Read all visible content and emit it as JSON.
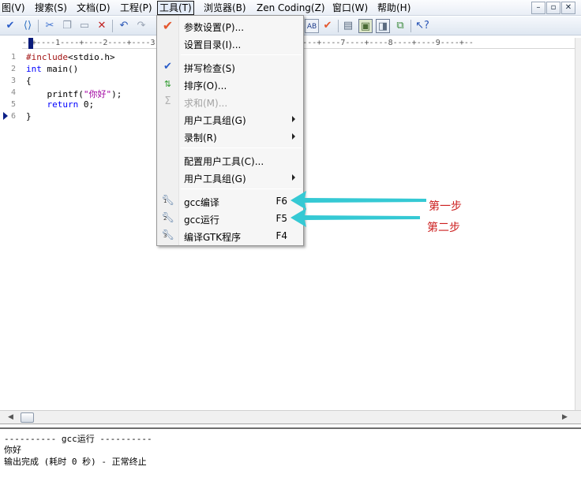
{
  "menubar": {
    "items": [
      "图(V)",
      "搜索(S)",
      "文档(D)",
      "工程(P)",
      "工具(T)",
      "浏览器(B)",
      "Zen Coding(Z)",
      "窗口(W)",
      "帮助(H)"
    ],
    "active": "工具(T)",
    "window_buttons": [
      "–",
      "▫",
      "✕"
    ]
  },
  "ruler": {
    "text": "--+----1----+----2----+----3----+----4----+----5----+----6----+----7----+----8----+----9----+--"
  },
  "editor": {
    "line_numbers": [
      "1",
      "2",
      "3",
      "4",
      "5",
      "6"
    ],
    "lines": {
      "l1_pp": "#include",
      "l1_rest": "<stdio.h>",
      "l2_kw": "int",
      "l2_rest": " main()",
      "l3": "{",
      "l4_a": "    printf(",
      "l4_str": "\"你好\"",
      "l4_b": ");",
      "l5_kw": "    return",
      "l5_rest": " 0;",
      "l6": "}"
    }
  },
  "output": {
    "lines": [
      "---------- gcc运行 ----------",
      "你好",
      "输出完成 (耗时 0 秒) - 正常终止"
    ]
  },
  "dropdown": {
    "items": [
      {
        "label": "参数设置(P)...",
        "icon": "checkmark-icon"
      },
      {
        "label": "设置目录(I)..."
      },
      {
        "label": "拼写检查(S)",
        "icon": "spellcheck-icon"
      },
      {
        "label": "排序(O)...",
        "icon": "sort-icon"
      },
      {
        "label": "求和(M)...",
        "icon": "sum-icon",
        "disabled": true
      },
      {
        "label": "用户工具组(G)",
        "submenu": true
      },
      {
        "label": "录制(R)",
        "submenu": true
      },
      {
        "label": "配置用户工具(C)..."
      },
      {
        "label": "用户工具组(G)",
        "submenu": true
      },
      {
        "label": "gcc编译",
        "shortcut": "F6",
        "tool_number": "1",
        "icon": "wrench-icon"
      },
      {
        "label": "gcc运行",
        "shortcut": "F5",
        "tool_number": "2",
        "icon": "wrench-icon"
      },
      {
        "label": "编译GTK程序",
        "shortcut": "F4",
        "tool_number": "3",
        "icon": "wrench-icon"
      }
    ]
  },
  "annotations": {
    "step1": "第一步",
    "step2": "第二步",
    "arrow_color": "#35c9d4",
    "text_color": "#cc1f1f"
  },
  "colors": {
    "keyword": "#0000ff",
    "preprocessor": "#a31515",
    "string": "#a000a0"
  }
}
